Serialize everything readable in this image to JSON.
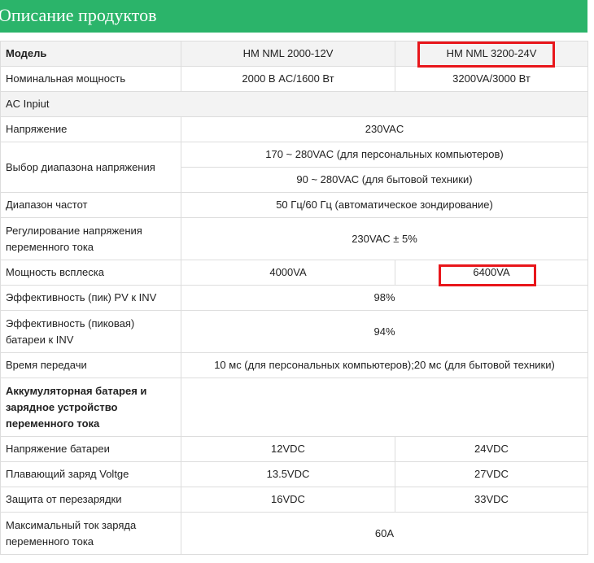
{
  "header": {
    "title": "Описание продуктов"
  },
  "table": {
    "model_label": "Модель",
    "model_a": "HM NML 2000-12V",
    "model_b": "HM NML 3200-24V",
    "rows": {
      "rated_power": {
        "label": "Номинальная мощность",
        "a": "2000 В AC/1600 Вт",
        "b": "3200VA/3000 Вт"
      },
      "ac_input": {
        "label": "AC Inpiut"
      },
      "voltage": {
        "label": "Напряжение",
        "value": "230VAC"
      },
      "voltage_range": {
        "label": "Выбор диапазона напряжения",
        "pc": "170 ~ 280VAC (для персональных компьютеров)",
        "appliance": "90 ~ 280VAC (для бытовой техники)"
      },
      "frequency": {
        "label": "Диапазон частот",
        "value": "50 Гц/60 Гц (автоматическое зондирование)"
      },
      "regulation": {
        "label_line1": "Регулирование напряжения",
        "label_line2": "переменного тока",
        "value": "230VAC ± 5%"
      },
      "surge": {
        "label": "Мощность всплеска",
        "a": "4000VA",
        "b": "6400VA"
      },
      "eff_pv": {
        "label": "Эффективность (пик) PV к INV",
        "value": "98%"
      },
      "eff_batt": {
        "label_line1": "Эффективность (пиковая)",
        "label_line2": "батареи к INV",
        "value": "94%"
      },
      "transfer": {
        "label": "Время передачи",
        "value": "10 мс (для персональных компьютеров);20 мс (для бытовой техники)"
      },
      "battery_section": {
        "line1": "Аккумуляторная батарея и",
        "line2": "зарядное устройство",
        "line3": "переменного тока"
      },
      "batt_voltage": {
        "label": "Напряжение батареи",
        "a": "12VDC",
        "b": "24VDC"
      },
      "float_charge": {
        "label": "Плавающий заряд Voltge",
        "a": "13.5VDC",
        "b": "27VDC"
      },
      "overcharge": {
        "label": "Защита от перезарядки",
        "a": "16VDC",
        "b": "33VDC"
      },
      "max_charge": {
        "label_line1": "Максимальный ток заряда",
        "label_line2": "переменного тока",
        "value": "60A"
      }
    }
  }
}
